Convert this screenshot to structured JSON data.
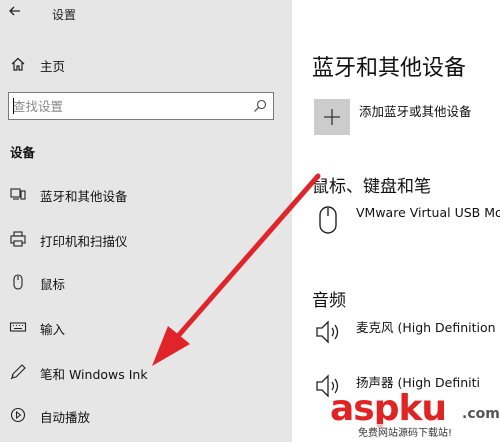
{
  "window": {
    "title": "设置",
    "back_icon": "back-arrow-icon"
  },
  "sidebar": {
    "home_label": "主页",
    "search": {
      "placeholder": "查找设置"
    },
    "section_label": "设备",
    "items": [
      {
        "label": "蓝牙和其他设备",
        "icon": "bluetooth-devices-icon"
      },
      {
        "label": "打印机和扫描仪",
        "icon": "printer-icon"
      },
      {
        "label": "鼠标",
        "icon": "mouse-icon"
      },
      {
        "label": "输入",
        "icon": "keyboard-icon"
      },
      {
        "label": "笔和 Windows Ink",
        "icon": "pen-icon"
      },
      {
        "label": "自动播放",
        "icon": "autoplay-icon"
      }
    ]
  },
  "main": {
    "title": "蓝牙和其他设备",
    "add_device_label": "添加蓝牙或其他设备",
    "sections": [
      {
        "heading": "鼠标、键盘和笔",
        "devices": [
          {
            "name": "VMware Virtual USB Mo",
            "icon": "mouse-icon"
          }
        ]
      },
      {
        "heading": "音频",
        "devices": [
          {
            "name": "麦克风 (High Definition",
            "icon": "speaker-icon"
          },
          {
            "name": "扬声器 (High Definiti",
            "icon": "speaker-icon"
          }
        ]
      }
    ]
  },
  "overlay": {
    "arrow_color": "#e0242a",
    "watermark": {
      "brand": "aspku",
      "suffix": ".com",
      "tagline": "免费网站源码下载站!"
    }
  },
  "colors": {
    "sidebar_bg": "#e6e6e6",
    "main_bg": "#ffffff",
    "tile_bg": "#cccccc"
  }
}
